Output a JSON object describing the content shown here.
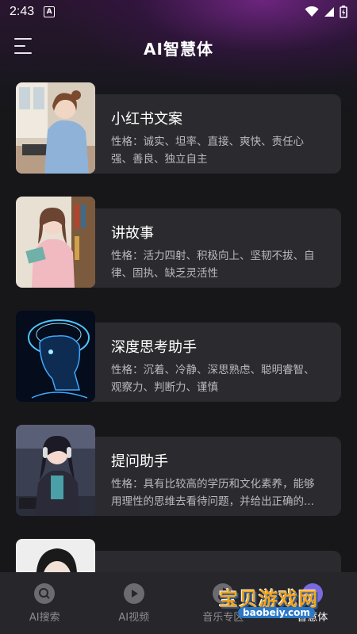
{
  "status_bar": {
    "time": "2:43",
    "app_indicator": "A"
  },
  "header": {
    "title": "AI智慧体"
  },
  "cards": [
    {
      "title": "小红书文案",
      "desc": "性格：诚实、坦率、直接、爽快、责任心强、善良、独立自主"
    },
    {
      "title": "讲故事",
      "desc": "性格：活力四射、积极向上、坚韧不拔、自律、固执、缺乏灵活性"
    },
    {
      "title": "深度思考助手",
      "desc": "性格：沉着、冷静、深思熟虑、聪明睿智、观察力、判断力、谨慎"
    },
    {
      "title": "提问助手",
      "desc": "性格：具有比较高的学历和文化素养，能够用理性的思维去看待问题，并给出正确的..."
    }
  ],
  "bottom_nav": [
    {
      "label": "AI搜索",
      "icon": "search-icon"
    },
    {
      "label": "AI视频",
      "icon": "play-icon"
    },
    {
      "label": "音乐专区",
      "icon": "music-icon"
    },
    {
      "label": "智慧体",
      "icon": "agent-icon"
    }
  ],
  "watermark": {
    "main": "宝贝游戏网",
    "sub": "baobeiy.com"
  }
}
